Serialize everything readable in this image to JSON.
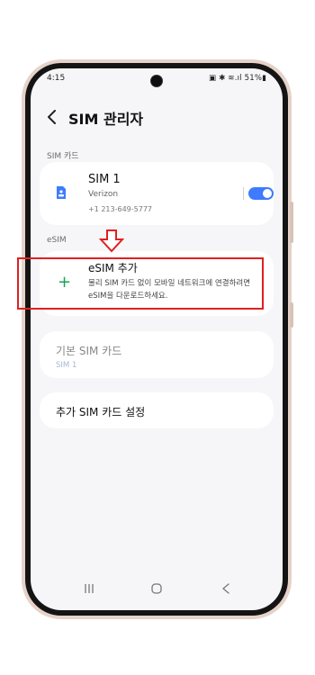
{
  "status_bar": {
    "time": "4:15",
    "indicators": "▣ ✱ ≋.ıl 51%▮"
  },
  "header": {
    "title": "SIM 관리자"
  },
  "sim_section": {
    "label": "SIM 카드",
    "sim": {
      "name": "SIM 1",
      "carrier": "Verizon",
      "number": "+1 213-649-5777",
      "enabled": true
    }
  },
  "esim_section": {
    "label": "eSIM",
    "add": {
      "title": "eSIM 추가",
      "description": "물리 SIM 카드 없이 모바일 네트워크에 연결하려면 eSIM을 다운로드하세요."
    }
  },
  "default_sim": {
    "title": "기본 SIM 카드",
    "value": "SIM 1"
  },
  "extra_settings": {
    "title": "추가 SIM 카드 설정"
  },
  "colors": {
    "accent": "#3e7bff",
    "highlight": "#e02020",
    "plus": "#1aa154"
  },
  "icons": [
    "back-icon",
    "sim-card-icon",
    "plus-icon",
    "down-arrow-icon",
    "recent-apps-icon",
    "home-icon",
    "nav-back-icon"
  ]
}
